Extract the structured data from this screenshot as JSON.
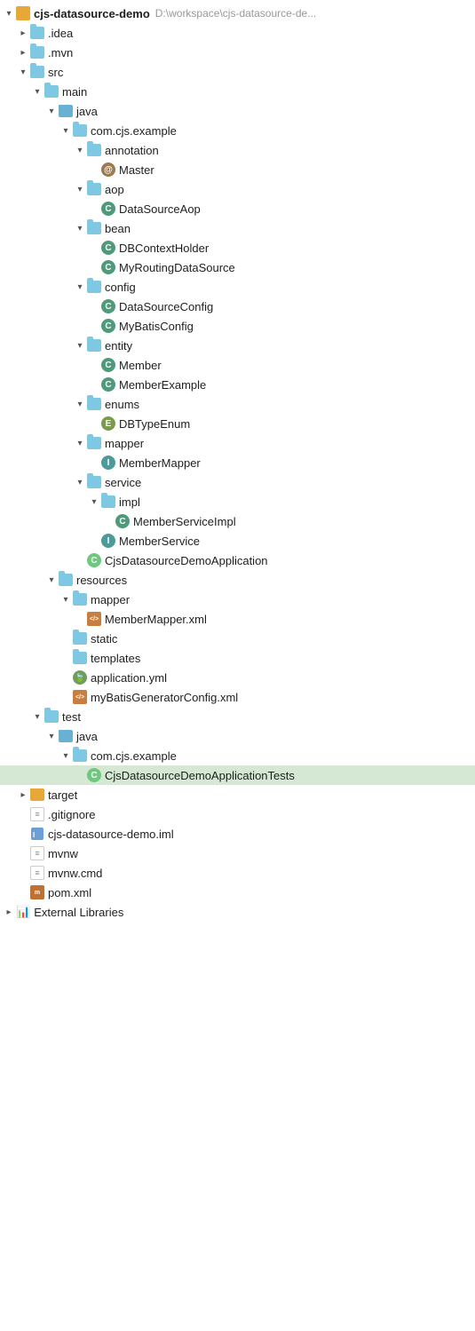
{
  "tree": {
    "root": {
      "name": "cjs-datasource-demo",
      "path": "D:\\workspace\\cjs-datasource-de...",
      "selected": false
    },
    "items": [
      {
        "id": "idea",
        "label": ".idea",
        "level": 1,
        "type": "folder",
        "state": "collapsed"
      },
      {
        "id": "mvn",
        "label": ".mvn",
        "level": 1,
        "type": "folder",
        "state": "collapsed"
      },
      {
        "id": "src",
        "label": "src",
        "level": 1,
        "type": "folder",
        "state": "expanded"
      },
      {
        "id": "main",
        "label": "main",
        "level": 2,
        "type": "folder",
        "state": "expanded"
      },
      {
        "id": "java",
        "label": "java",
        "level": 3,
        "type": "folder-blue",
        "state": "expanded"
      },
      {
        "id": "com_cjs_example",
        "label": "com.cjs.example",
        "level": 4,
        "type": "folder",
        "state": "expanded"
      },
      {
        "id": "annotation",
        "label": "annotation",
        "level": 5,
        "type": "folder",
        "state": "expanded"
      },
      {
        "id": "Master",
        "label": "Master",
        "level": 6,
        "type": "annotation",
        "state": "leaf"
      },
      {
        "id": "aop",
        "label": "aop",
        "level": 5,
        "type": "folder",
        "state": "expanded"
      },
      {
        "id": "DataSourceAop",
        "label": "DataSourceAop",
        "level": 6,
        "type": "class",
        "state": "leaf"
      },
      {
        "id": "bean",
        "label": "bean",
        "level": 5,
        "type": "folder",
        "state": "expanded"
      },
      {
        "id": "DBContextHolder",
        "label": "DBContextHolder",
        "level": 6,
        "type": "class",
        "state": "leaf"
      },
      {
        "id": "MyRoutingDataSource",
        "label": "MyRoutingDataSource",
        "level": 6,
        "type": "class",
        "state": "leaf"
      },
      {
        "id": "config",
        "label": "config",
        "level": 5,
        "type": "folder",
        "state": "expanded"
      },
      {
        "id": "DataSourceConfig",
        "label": "DataSourceConfig",
        "level": 6,
        "type": "class",
        "state": "leaf"
      },
      {
        "id": "MyBatisConfig",
        "label": "MyBatisConfig",
        "level": 6,
        "type": "class",
        "state": "leaf"
      },
      {
        "id": "entity",
        "label": "entity",
        "level": 5,
        "type": "folder",
        "state": "expanded"
      },
      {
        "id": "Member",
        "label": "Member",
        "level": 6,
        "type": "class",
        "state": "leaf"
      },
      {
        "id": "MemberExample",
        "label": "MemberExample",
        "level": 6,
        "type": "class",
        "state": "leaf"
      },
      {
        "id": "enums",
        "label": "enums",
        "level": 5,
        "type": "folder",
        "state": "expanded"
      },
      {
        "id": "DBTypeEnum",
        "label": "DBTypeEnum",
        "level": 6,
        "type": "enum",
        "state": "leaf"
      },
      {
        "id": "mapper",
        "label": "mapper",
        "level": 5,
        "type": "folder",
        "state": "expanded"
      },
      {
        "id": "MemberMapper",
        "label": "MemberMapper",
        "level": 6,
        "type": "interface",
        "state": "leaf"
      },
      {
        "id": "service",
        "label": "service",
        "level": 5,
        "type": "folder",
        "state": "expanded"
      },
      {
        "id": "impl",
        "label": "impl",
        "level": 6,
        "type": "folder",
        "state": "expanded"
      },
      {
        "id": "MemberServiceImpl",
        "label": "MemberServiceImpl",
        "level": 7,
        "type": "class",
        "state": "leaf"
      },
      {
        "id": "MemberService",
        "label": "MemberService",
        "level": 6,
        "type": "interface",
        "state": "leaf"
      },
      {
        "id": "CjsDatasourceDemoApplication",
        "label": "CjsDatasourceDemoApplication",
        "level": 5,
        "type": "spring-class",
        "state": "leaf"
      },
      {
        "id": "resources",
        "label": "resources",
        "level": 3,
        "type": "folder",
        "state": "expanded"
      },
      {
        "id": "mapper_res",
        "label": "mapper",
        "level": 4,
        "type": "folder",
        "state": "expanded"
      },
      {
        "id": "MemberMapper_xml",
        "label": "MemberMapper.xml",
        "level": 5,
        "type": "xml",
        "state": "leaf"
      },
      {
        "id": "static",
        "label": "static",
        "level": 4,
        "type": "folder-empty",
        "state": "leaf"
      },
      {
        "id": "templates",
        "label": "templates",
        "level": 4,
        "type": "folder-empty",
        "state": "leaf"
      },
      {
        "id": "application_yml",
        "label": "application.yml",
        "level": 4,
        "type": "yaml",
        "state": "leaf"
      },
      {
        "id": "myBatisGeneratorConfig_xml",
        "label": "myBatisGeneratorConfig.xml",
        "level": 4,
        "type": "xml",
        "state": "leaf"
      },
      {
        "id": "test",
        "label": "test",
        "level": 2,
        "type": "folder",
        "state": "expanded"
      },
      {
        "id": "java_test",
        "label": "java",
        "level": 3,
        "type": "folder-blue",
        "state": "expanded"
      },
      {
        "id": "com_cjs_example_test",
        "label": "com.cjs.example",
        "level": 4,
        "type": "folder",
        "state": "expanded"
      },
      {
        "id": "CjsDatasourceDemoApplicationTests",
        "label": "CjsDatasourceDemoApplicationTests",
        "level": 5,
        "type": "spring-class",
        "state": "leaf",
        "selected": true
      },
      {
        "id": "target",
        "label": "target",
        "level": 1,
        "type": "folder-orange",
        "state": "collapsed"
      },
      {
        "id": "gitignore",
        "label": ".gitignore",
        "level": 1,
        "type": "text",
        "state": "leaf"
      },
      {
        "id": "iml",
        "label": "cjs-datasource-demo.iml",
        "level": 1,
        "type": "iml",
        "state": "leaf"
      },
      {
        "id": "mvnw",
        "label": "mvnw",
        "level": 1,
        "type": "text",
        "state": "leaf"
      },
      {
        "id": "mvnw_cmd",
        "label": "mvnw.cmd",
        "level": 1,
        "type": "text",
        "state": "leaf"
      },
      {
        "id": "pom_xml",
        "label": "pom.xml",
        "level": 1,
        "type": "pom",
        "state": "leaf"
      },
      {
        "id": "external_libraries",
        "label": "External Libraries",
        "level": 0,
        "type": "ext-lib",
        "state": "collapsed"
      }
    ]
  }
}
